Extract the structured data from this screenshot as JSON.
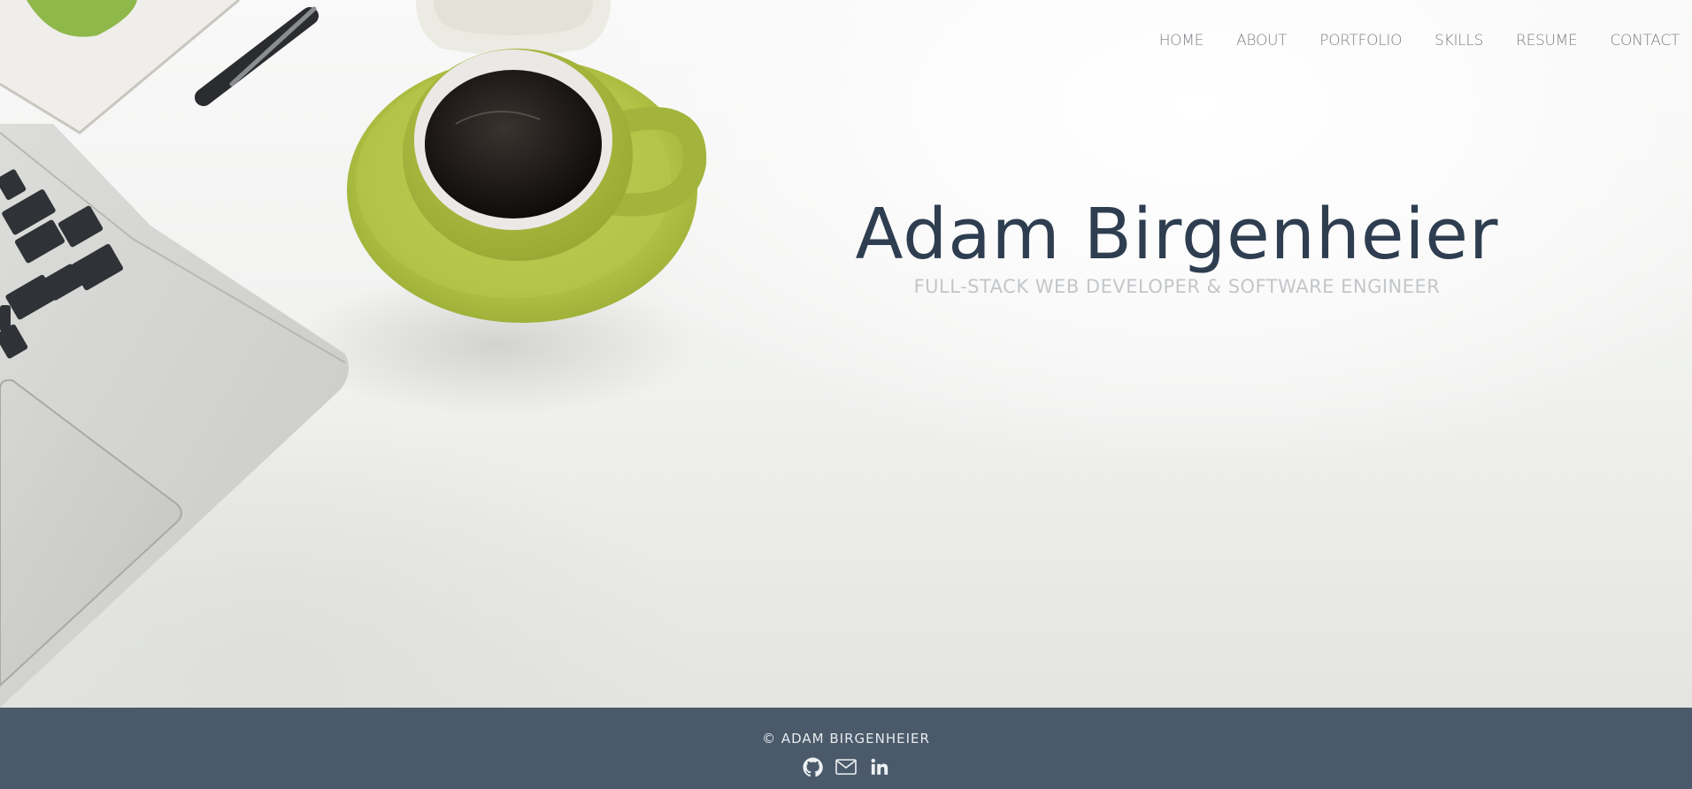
{
  "nav": {
    "items": [
      {
        "label": "HOME"
      },
      {
        "label": "ABOUT"
      },
      {
        "label": "PORTFOLIO"
      },
      {
        "label": "SKILLS"
      },
      {
        "label": "RESUME"
      },
      {
        "label": "CONTACT"
      }
    ]
  },
  "hero": {
    "title": "Adam Birgenheier",
    "subtitle": "FULL-STACK WEB DEVELOPER & SOFTWARE ENGINEER"
  },
  "footer": {
    "copyright": "© ADAM BIRGENHEIER",
    "icons": [
      "github-icon",
      "mail-icon",
      "linkedin-icon"
    ]
  },
  "colors": {
    "title": "#2e3e50",
    "subtitle": "#c3c6c9",
    "nav": "#7b7f84",
    "footer_bg": "#4a5a6b",
    "footer_text": "#e6eaee",
    "cup_green": "#a9bb3f"
  }
}
